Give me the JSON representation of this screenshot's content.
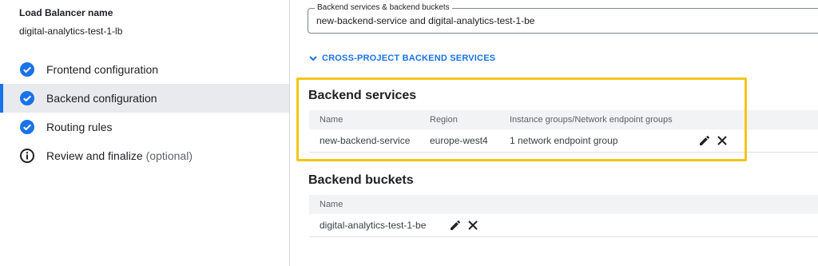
{
  "sidebar": {
    "lb_name_label": "Load Balancer name",
    "lb_name_value": "digital-analytics-test-1-lb",
    "steps": [
      {
        "label": "Frontend configuration",
        "icon": "check-circle-icon",
        "optional": ""
      },
      {
        "label": "Backend configuration",
        "icon": "check-circle-icon",
        "optional": "",
        "active": true
      },
      {
        "label": "Routing rules",
        "icon": "check-circle-icon",
        "optional": ""
      },
      {
        "label": "Review and finalize",
        "icon": "info-icon",
        "optional": "(optional)"
      }
    ]
  },
  "main": {
    "backend_field": {
      "legend": "Backend services & backend buckets",
      "value": "new-backend-service and digital-analytics-test-1-be"
    },
    "cross_project_link": "CROSS-PROJECT BACKEND SERVICES",
    "backend_services": {
      "title": "Backend services",
      "headers": [
        "Name",
        "Region",
        "Instance groups/Network endpoint groups"
      ],
      "rows": [
        {
          "name": "new-backend-service",
          "region": "europe-west4",
          "groups": "1 network endpoint group"
        }
      ]
    },
    "backend_buckets": {
      "title": "Backend buckets",
      "headers": [
        "Name"
      ],
      "rows": [
        {
          "name": "digital-analytics-test-1-be"
        }
      ]
    }
  },
  "colors": {
    "accent": "#1a73e8",
    "highlight": "#f5c518"
  }
}
